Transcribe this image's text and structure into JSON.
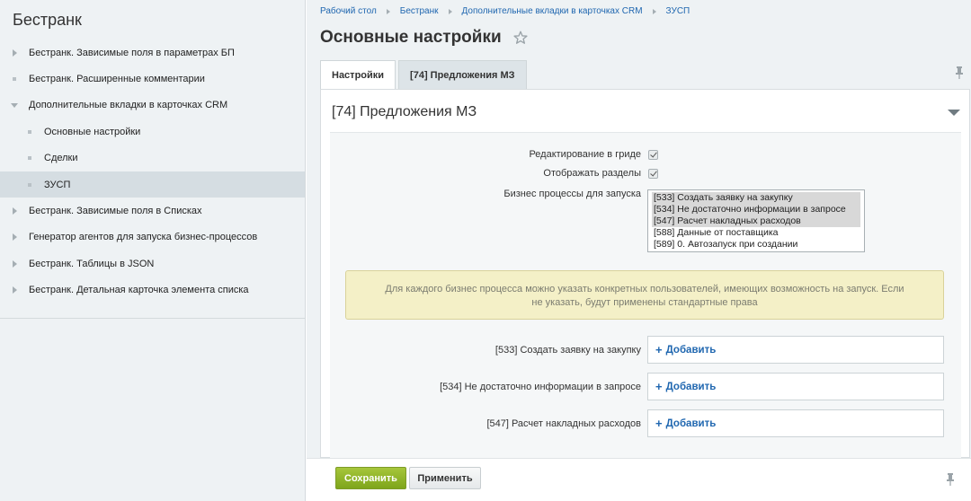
{
  "sidebar": {
    "title": "Бестранк",
    "items": [
      {
        "label": "Бестранк. Зависимые поля в параметрах БП",
        "marker": "arrow-right"
      },
      {
        "label": "Бестранк. Расширенные комментарии",
        "marker": "square"
      },
      {
        "label": "Дополнительные вкладки в карточках CRM",
        "marker": "arrow-down"
      },
      {
        "label": "Основные настройки",
        "marker": "square"
      },
      {
        "label": "Сделки",
        "marker": "square"
      },
      {
        "label": "ЗУСП",
        "marker": "square"
      },
      {
        "label": "Бестранк. Зависимые поля в Списках",
        "marker": "arrow-right"
      },
      {
        "label": "Генератор агентов для запуска бизнес-процессов",
        "marker": "arrow-right"
      },
      {
        "label": "Бестранк. Таблицы в JSON",
        "marker": "arrow-right"
      },
      {
        "label": "Бестранк. Детальная карточка элемента списка",
        "marker": "arrow-right"
      }
    ]
  },
  "breadcrumb": [
    "Рабочий стол",
    "Бестранк",
    "Дополнительные вкладки в карточках CRM",
    "ЗУСП"
  ],
  "page": {
    "title": "Основные настройки"
  },
  "tabs": [
    {
      "label": "Настройки"
    },
    {
      "label": "[74] Предложения МЗ"
    }
  ],
  "panel": {
    "title": "[74] Предложения МЗ",
    "grid_edit_label": "Редактирование в гриде",
    "show_sections_label": "Отображать разделы",
    "bp_label": "Бизнес процессы для запуска",
    "bp_options": [
      {
        "text": "[533] Создать заявку на закупку",
        "selected": true
      },
      {
        "text": "[534] Не достаточно информации в запросе",
        "selected": true
      },
      {
        "text": "[547] Расчет накладных расходов",
        "selected": true
      },
      {
        "text": "[588] Данные от поставщика",
        "selected": false
      },
      {
        "text": "[589] 0. Автозапуск при создании",
        "selected": false
      }
    ],
    "notice": "Для каждого бизнес процесса можно указать конкретных пользователей, имеющих возможность на запуск. Если не указать, будут применены стандартные права",
    "add_rows": [
      {
        "label": "[533] Создать заявку на закупку",
        "button": "Добавить"
      },
      {
        "label": "[534] Не достаточно информации в запросе",
        "button": "Добавить"
      },
      {
        "label": "[547] Расчет накладных расходов",
        "button": "Добавить"
      }
    ]
  },
  "footer": {
    "save": "Сохранить",
    "apply": "Применить"
  }
}
